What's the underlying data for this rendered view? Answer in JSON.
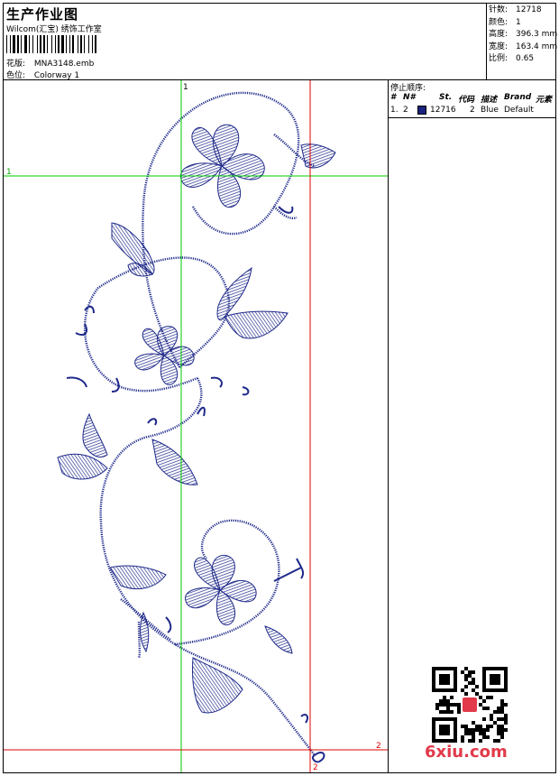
{
  "header": {
    "title": "生产作业图",
    "company": "Wilcom(汇宝) 绣饰工作室",
    "design_label": "花版:",
    "design_value": "MNA3148.emb",
    "colorway_label": "色位:",
    "colorway_value": "Colorway 1"
  },
  "stats": [
    {
      "label": "针数:",
      "value": "12718"
    },
    {
      "label": "颜色:",
      "value": "1"
    },
    {
      "label": "高度:",
      "value": "396.3 mm"
    },
    {
      "label": "宽度:",
      "value": "163.4 mm"
    },
    {
      "label": "比例:",
      "value": "0.65"
    }
  ],
  "guides": {
    "green_label": "1",
    "red_label": "2"
  },
  "stop_sequence": {
    "title": "停止顺序:",
    "columns": [
      "#",
      "N#",
      "St.",
      "代码",
      "描述",
      "Brand",
      "元素"
    ],
    "rows": [
      {
        "index": "1.",
        "needle": "2",
        "stitches": "12716",
        "code": "2",
        "description": "Blue",
        "brand": "Default",
        "color": "#1a237e"
      }
    ]
  },
  "watermark": "6xiu.com",
  "colors": {
    "thread": "#1f2a8a",
    "guide_green": "#00cc00",
    "guide_red": "#e00000",
    "watermark": "#e23a4a"
  }
}
